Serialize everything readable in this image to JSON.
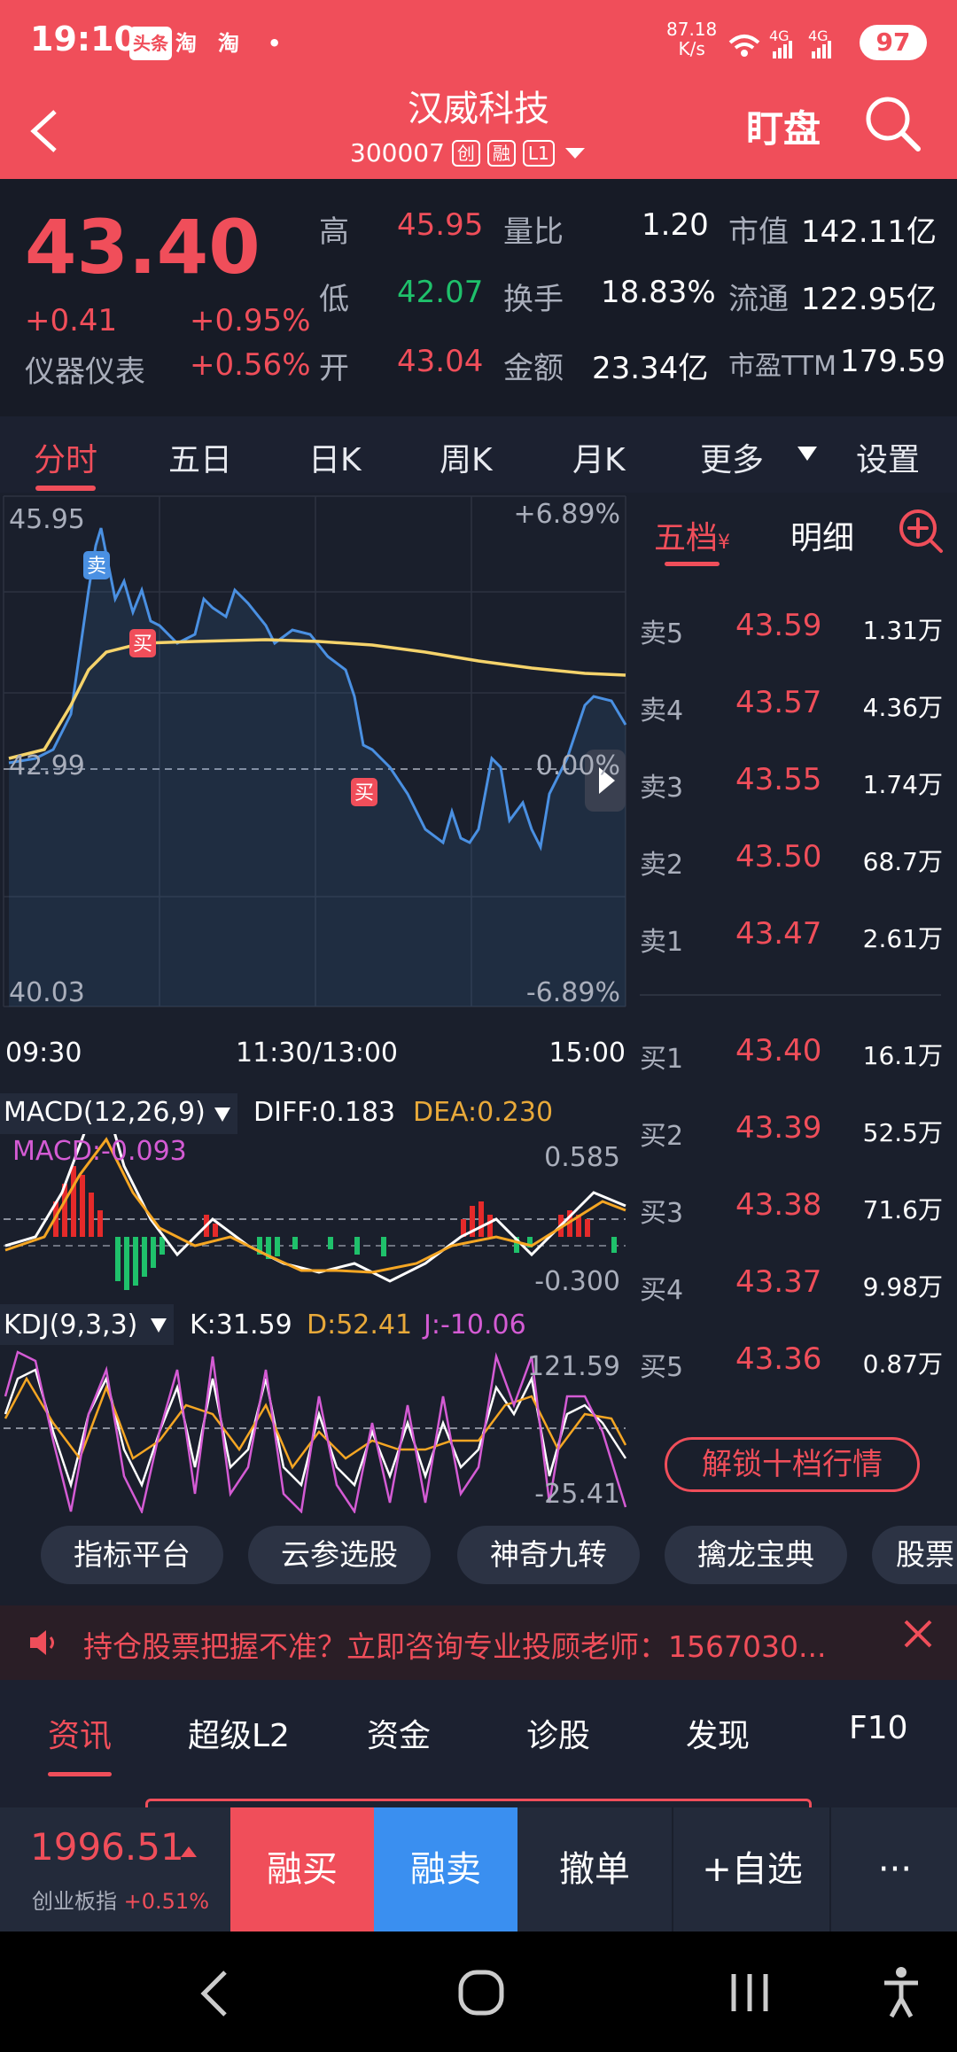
{
  "status": {
    "time": "19:10",
    "icons": [
      "头条",
      "淘",
      "淘",
      "•"
    ],
    "net_speed": "87.18\nK/s",
    "battery": "97",
    "signal": [
      "4G",
      "4G"
    ]
  },
  "header": {
    "name": "汉威科技",
    "code": "300007",
    "tags": [
      "创",
      "融",
      "L1"
    ],
    "watch_label": "盯盘"
  },
  "quote": {
    "price": "43.40",
    "change": "+0.41",
    "change_pct": "+0.95%",
    "sector": "仪器仪表",
    "sector_pct": "+0.56%",
    "high_label": "高",
    "high": "45.95",
    "low_label": "低",
    "low": "42.07",
    "open_label": "开",
    "open": "43.04",
    "vol_ratio_label": "量比",
    "vol_ratio": "1.20",
    "turnover_label": "换手",
    "turnover": "18.83%",
    "amount_label": "金额",
    "amount": "23.34亿",
    "mcap_label": "市值",
    "mcap": "142.11亿",
    "float_label": "流通",
    "float": "122.95亿",
    "pe_label": "市盈TTM",
    "pe": "179.59"
  },
  "tabs": [
    "分时",
    "五日",
    "日K",
    "周K",
    "月K",
    "更多",
    "设置"
  ],
  "chart": {
    "y_max": "45.95",
    "y_min": "40.03",
    "y_mid": "42.99",
    "pct_max": "+6.89%",
    "pct_min": "-6.89%",
    "pct_mid": "0.00%",
    "x_start": "09:30",
    "x_mid": "11:30/13:00",
    "x_end": "15:00",
    "markers": [
      "卖",
      "买",
      "买"
    ],
    "macd_title": "MACD(12,26,9)",
    "diff": "DIFF:0.183",
    "dea": "DEA:0.230",
    "macd": "MACD:-0.093",
    "macd_max": "0.585",
    "macd_min": "-0.300",
    "kdj_title": "KDJ(9,3,3)",
    "k": "K:31.59",
    "d": "D:52.41",
    "j": "J:-10.06",
    "kdj_max": "121.59",
    "kdj_min": "-25.41"
  },
  "orderbook": {
    "tabs": [
      "五档",
      "明细"
    ],
    "sells": [
      {
        "label": "卖5",
        "price": "43.59",
        "vol": "1.31万"
      },
      {
        "label": "卖4",
        "price": "43.57",
        "vol": "4.36万"
      },
      {
        "label": "卖3",
        "price": "43.55",
        "vol": "1.74万"
      },
      {
        "label": "卖2",
        "price": "43.50",
        "vol": "68.7万"
      },
      {
        "label": "卖1",
        "price": "43.47",
        "vol": "2.61万"
      }
    ],
    "buys": [
      {
        "label": "买1",
        "price": "43.40",
        "vol": "16.1万"
      },
      {
        "label": "买2",
        "price": "43.39",
        "vol": "52.5万"
      },
      {
        "label": "买3",
        "price": "43.38",
        "vol": "71.6万"
      },
      {
        "label": "买4",
        "price": "43.37",
        "vol": "9.98万"
      },
      {
        "label": "买5",
        "price": "43.36",
        "vol": "0.87万"
      }
    ],
    "unlock": "解锁十档行情"
  },
  "pills": [
    "指标平台",
    "云参选股",
    "神奇九转",
    "擒龙宝典",
    "股票"
  ],
  "ad": {
    "text": "持仓股票把握不准？立即咨询专业投顾老师：1567030..."
  },
  "bottom_tabs": [
    "资讯",
    "超级L2",
    "资金",
    "诊股",
    "发现",
    "F10"
  ],
  "trade": {
    "index_value": "1996.51",
    "index_name": "创业板指",
    "index_pct": "+0.51%",
    "buy": "融买",
    "sell": "融卖",
    "cancel": "撤单",
    "watchlist": "+自选",
    "more": "···"
  },
  "colors": {
    "brand": "#f04e5a",
    "up": "#f04e5a",
    "down": "#1fc16b",
    "price_line": "#4a90e2",
    "avg_line": "#f5d36b"
  }
}
